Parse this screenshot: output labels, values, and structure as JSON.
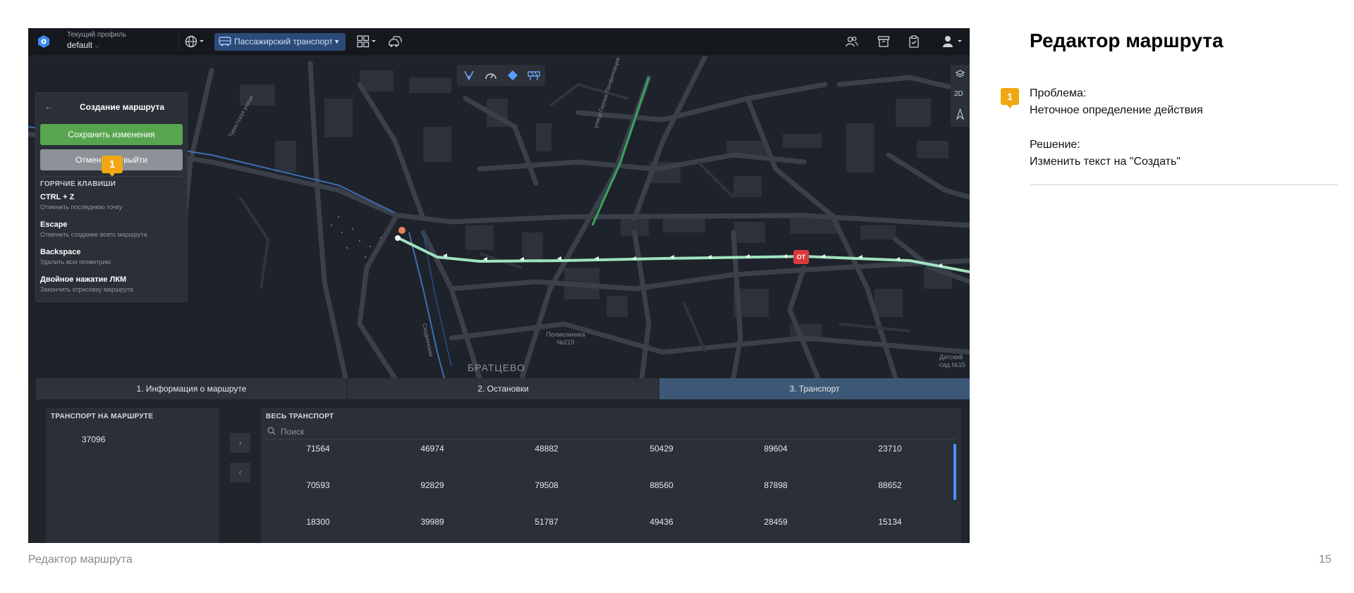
{
  "app": {
    "profile_caption": "Текущий профиль",
    "profile_value": "default",
    "transport_mode": "Пассажирский транспорт"
  },
  "map": {
    "labels": {
      "district": "БРАТЦЕВО",
      "clinic": "Поликлиника №219",
      "kindergarten": "Детский сад №15",
      "street_right": "улица Героев Панфиловцев",
      "street_bottom": "Сходненская",
      "street_left": "Туристская улица"
    },
    "view_mode": "2D",
    "bus_stop_label": "ОТ"
  },
  "route_panel": {
    "title": "Создание маршрута",
    "save_label": "Сохранить изменения",
    "cancel_label": "Отменить и выйти",
    "hotkeys_heading": "ГОРЯЧИЕ КЛАВИШИ",
    "hotkeys": [
      {
        "key": "CTRL + Z",
        "desc": "Отменить последнюю точку"
      },
      {
        "key": "Escape",
        "desc": "Отменить создание всего маршрута"
      },
      {
        "key": "Backspace",
        "desc": "Удалить всю геометрию"
      },
      {
        "key": "Двойное нажатие ЛКМ",
        "desc": "Закончить отрисовку маршрута"
      }
    ]
  },
  "annotation_number": "1",
  "tabs": [
    {
      "label": "1. Информация о маршруте",
      "active": false
    },
    {
      "label": "2. Остановки",
      "active": false
    },
    {
      "label": "3. Транспорт",
      "active": true
    }
  ],
  "route_transport": {
    "heading": "ТРАНСПОРТ НА МАРШРУТЕ",
    "items": [
      "37096"
    ]
  },
  "all_transport": {
    "heading": "ВЕСЬ ТРАНСПОРТ",
    "search_placeholder": "Поиск",
    "rows": [
      [
        "71564",
        "46974",
        "48882",
        "50429",
        "89604",
        "23710"
      ],
      [
        "70593",
        "92829",
        "79508",
        "88560",
        "87898",
        "88652"
      ],
      [
        "18300",
        "39989",
        "51787",
        "49436",
        "28459",
        "15134"
      ]
    ]
  },
  "slide": {
    "title": "Редактор маршрута",
    "problem_label": "Проблема:",
    "problem_text": "Неточное определение действия",
    "solution_label": "Решение:",
    "solution_text": "Изменить текст на \"Создать\"",
    "footer_title": "Редактор маршрута",
    "page_number": "15"
  },
  "colors": {
    "accent_marker": "#f0a712",
    "save_button": "#58a54f",
    "cancel_button": "#8d9299",
    "route_line": "#9fe3bf",
    "active_tab": "#3d5877"
  }
}
